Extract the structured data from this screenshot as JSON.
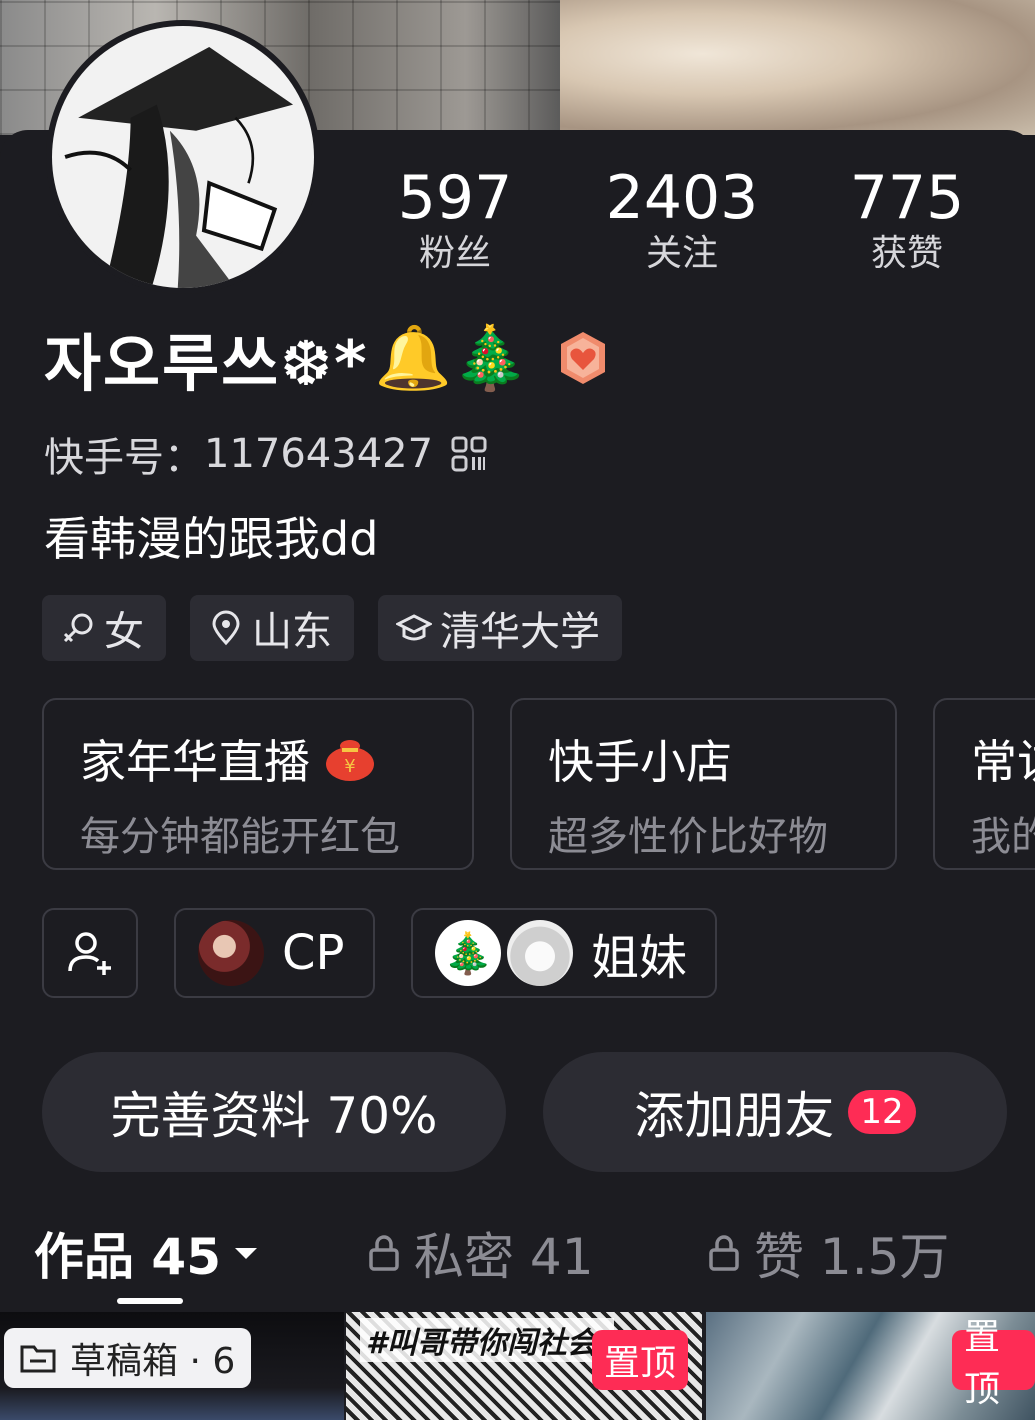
{
  "stats": [
    {
      "value": "597",
      "label": "粉丝"
    },
    {
      "value": "2403",
      "label": "关注"
    },
    {
      "value": "775",
      "label": "获赞"
    }
  ],
  "profile": {
    "name": "자오루쓰❆*",
    "emojis": "🔔🎄",
    "uid_label": "快手号：",
    "uid": "117643427",
    "bio": "看韩漫的跟我dd"
  },
  "tags": {
    "gender": "女",
    "location": "山东",
    "school": "清华大学"
  },
  "features": [
    {
      "title": "家年华直播",
      "subtitle": "每分钟都能开红包"
    },
    {
      "title": "快手小店",
      "subtitle": "超多性价比好物"
    },
    {
      "title": "常访",
      "subtitle": "我的"
    }
  ],
  "relations": {
    "cp_label": "CP",
    "sisters_label": "姐妹"
  },
  "actions": {
    "complete_profile": "完善资料 70%",
    "add_friends": "添加朋友",
    "add_friends_badge": "12"
  },
  "tabs": {
    "works": "作品 45",
    "private": "私密 41",
    "likes": "赞 1.5万"
  },
  "thumbnails": {
    "drafts": "草稿箱 · 6",
    "pinned": "置顶",
    "video2_caption": "#叫哥带你闯社会/"
  },
  "colors": {
    "background": "#1c1c21",
    "chip": "#2c2c33",
    "accent_red": "#fe2c55"
  }
}
